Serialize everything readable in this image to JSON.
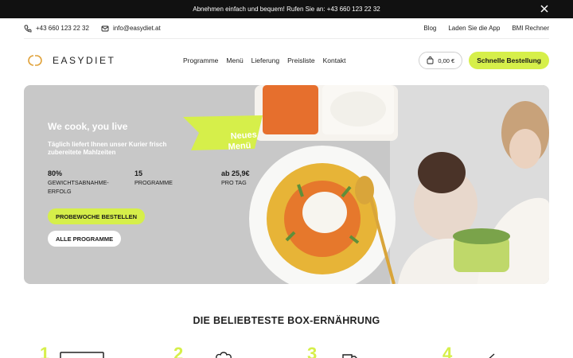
{
  "announcement": {
    "text": "Abnehmen einfach und bequem! Rufen Sie an: +43 660 123 22 32"
  },
  "contact": {
    "phone": "+43 660 123 22 32",
    "email": "info@easydiet.at"
  },
  "top_links": [
    "Blog",
    "Laden Sie die App",
    "BMI Rechner"
  ],
  "logo": {
    "text": "EASYDIET"
  },
  "nav": [
    "Programme",
    "Menü",
    "Lieferung",
    "Preisliste",
    "Kontakt"
  ],
  "cart": {
    "amount": "0,00 €"
  },
  "order_button": "Schnelle Bestellung",
  "hero": {
    "title": "We cook, you live",
    "subtitle": "Täglich liefert Ihnen unser Kurier frisch zubereitete Mahlzeiten",
    "badge": "Neues\nMenü",
    "stats": [
      {
        "value": "80%",
        "label": "GEWICHTSABNAHME-\nERFOLG"
      },
      {
        "value": "15",
        "label": "PROGRAMME"
      },
      {
        "value": "ab 25,9€",
        "label": "PRO TAG"
      }
    ],
    "primary_button": "PROBEWOCHE BESTELLEN",
    "secondary_button": "ALLE PROGRAMME"
  },
  "section": {
    "title": "DIE BELIEBTESTE BOX-ERNÄHRUNG"
  },
  "steps": [
    "1",
    "2",
    "3",
    "4"
  ],
  "colors": {
    "accent": "#d6ef4a",
    "topbar": "#111111",
    "hero_bg": "#c8c8c8"
  }
}
